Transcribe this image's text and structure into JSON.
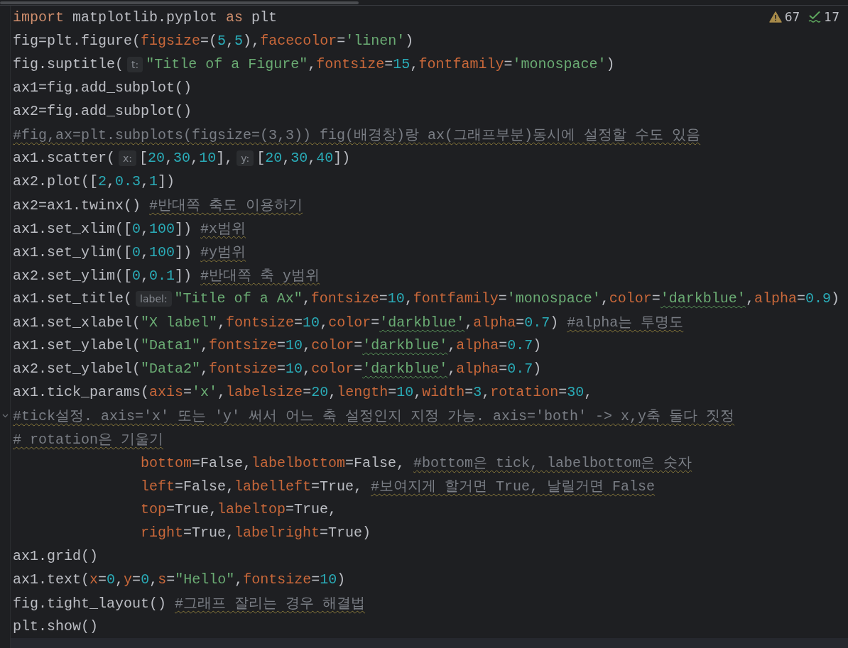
{
  "inspections": {
    "warnings": "67",
    "passed": "17"
  },
  "lines": [
    {
      "tokens": [
        {
          "text": "import",
          "kind": "keyword"
        },
        {
          "text": " matplotlib.pyplot ",
          "kind": "plain"
        },
        {
          "text": "as",
          "kind": "keyword"
        },
        {
          "text": " plt",
          "kind": "plain"
        }
      ]
    },
    {
      "tokens": [
        {
          "text": "fig=plt.figure(",
          "kind": "plain"
        },
        {
          "text": "figsize",
          "kind": "param"
        },
        {
          "text": "=(",
          "kind": "plain"
        },
        {
          "text": "5",
          "kind": "number"
        },
        {
          "text": ",",
          "kind": "plain"
        },
        {
          "text": "5",
          "kind": "number"
        },
        {
          "text": "),",
          "kind": "plain"
        },
        {
          "text": "facecolor",
          "kind": "param"
        },
        {
          "text": "=",
          "kind": "plain"
        },
        {
          "text": "'linen'",
          "kind": "string"
        },
        {
          "text": ")",
          "kind": "plain"
        }
      ]
    },
    {
      "tokens": [
        {
          "text": "fig.suptitle(",
          "kind": "plain"
        },
        {
          "text": "t:",
          "kind": "hint"
        },
        {
          "text": "\"Title of a Figure\"",
          "kind": "string"
        },
        {
          "text": ",",
          "kind": "plain"
        },
        {
          "text": "fontsize",
          "kind": "param"
        },
        {
          "text": "=",
          "kind": "plain"
        },
        {
          "text": "15",
          "kind": "number"
        },
        {
          "text": ",",
          "kind": "plain"
        },
        {
          "text": "fontfamily",
          "kind": "param"
        },
        {
          "text": "=",
          "kind": "plain"
        },
        {
          "text": "'monospace'",
          "kind": "string"
        },
        {
          "text": ")",
          "kind": "plain"
        }
      ]
    },
    {
      "tokens": [
        {
          "text": "ax1=fig.add_subplot()",
          "kind": "plain"
        }
      ]
    },
    {
      "tokens": [
        {
          "text": "ax2=fig.add_subplot()",
          "kind": "plain"
        }
      ]
    },
    {
      "tokens": [
        {
          "text": "#fig,ax=plt.subplots(figsize=(3,3)) fig(배경창)랑 ax(그래프부분)동시에 설정할 수도 있음",
          "kind": "comment",
          "underline": true
        }
      ]
    },
    {
      "tokens": [
        {
          "text": "ax1.scatter(",
          "kind": "plain"
        },
        {
          "text": "x:",
          "kind": "hint"
        },
        {
          "text": "[",
          "kind": "plain"
        },
        {
          "text": "20",
          "kind": "number"
        },
        {
          "text": ",",
          "kind": "plain"
        },
        {
          "text": "30",
          "kind": "number"
        },
        {
          "text": ",",
          "kind": "plain"
        },
        {
          "text": "10",
          "kind": "number"
        },
        {
          "text": "],",
          "kind": "plain"
        },
        {
          "text": "y:",
          "kind": "hint"
        },
        {
          "text": "[",
          "kind": "plain"
        },
        {
          "text": "20",
          "kind": "number"
        },
        {
          "text": ",",
          "kind": "plain"
        },
        {
          "text": "30",
          "kind": "number"
        },
        {
          "text": ",",
          "kind": "plain"
        },
        {
          "text": "40",
          "kind": "number"
        },
        {
          "text": "])",
          "kind": "plain"
        }
      ]
    },
    {
      "tokens": [
        {
          "text": "ax2.plot([",
          "kind": "plain"
        },
        {
          "text": "2",
          "kind": "number"
        },
        {
          "text": ",",
          "kind": "plain"
        },
        {
          "text": "0.3",
          "kind": "number"
        },
        {
          "text": ",",
          "kind": "plain"
        },
        {
          "text": "1",
          "kind": "number"
        },
        {
          "text": "])",
          "kind": "plain"
        }
      ]
    },
    {
      "tokens": [
        {
          "text": "ax2=ax1.twinx() ",
          "kind": "plain"
        },
        {
          "text": "#반대쪽 축도 이용하기",
          "kind": "comment",
          "underline": true
        }
      ]
    },
    {
      "tokens": [
        {
          "text": "ax1.set_xlim([",
          "kind": "plain"
        },
        {
          "text": "0",
          "kind": "number"
        },
        {
          "text": ",",
          "kind": "plain"
        },
        {
          "text": "100",
          "kind": "number"
        },
        {
          "text": "]) ",
          "kind": "plain"
        },
        {
          "text": "#x범위",
          "kind": "comment",
          "underline": true
        }
      ]
    },
    {
      "tokens": [
        {
          "text": "ax1.set_ylim([",
          "kind": "plain"
        },
        {
          "text": "0",
          "kind": "number"
        },
        {
          "text": ",",
          "kind": "plain"
        },
        {
          "text": "100",
          "kind": "number"
        },
        {
          "text": "]) ",
          "kind": "plain"
        },
        {
          "text": "#y범위",
          "kind": "comment",
          "underline": true
        }
      ]
    },
    {
      "tokens": [
        {
          "text": "ax2.set_ylim([",
          "kind": "plain"
        },
        {
          "text": "0",
          "kind": "number"
        },
        {
          "text": ",",
          "kind": "plain"
        },
        {
          "text": "0.1",
          "kind": "number"
        },
        {
          "text": "]) ",
          "kind": "plain"
        },
        {
          "text": "#반대쪽 축 y범위",
          "kind": "comment",
          "underline": true
        }
      ]
    },
    {
      "tokens": [
        {
          "text": "ax1.set_title(",
          "kind": "plain"
        },
        {
          "text": "label:",
          "kind": "hint"
        },
        {
          "text": "\"Title of a Ax\"",
          "kind": "string"
        },
        {
          "text": ",",
          "kind": "plain"
        },
        {
          "text": "fontsize",
          "kind": "param"
        },
        {
          "text": "=",
          "kind": "plain"
        },
        {
          "text": "10",
          "kind": "number"
        },
        {
          "text": ",",
          "kind": "plain"
        },
        {
          "text": "fontfamily",
          "kind": "param"
        },
        {
          "text": "=",
          "kind": "plain"
        },
        {
          "text": "'monospace'",
          "kind": "string"
        },
        {
          "text": ",",
          "kind": "plain"
        },
        {
          "text": "color",
          "kind": "param"
        },
        {
          "text": "=",
          "kind": "plain"
        },
        {
          "text": "'darkblue'",
          "kind": "string",
          "underline": true
        },
        {
          "text": ",",
          "kind": "plain"
        },
        {
          "text": "alpha",
          "kind": "param"
        },
        {
          "text": "=",
          "kind": "plain"
        },
        {
          "text": "0.9",
          "kind": "number"
        },
        {
          "text": ")",
          "kind": "plain"
        }
      ]
    },
    {
      "tokens": [
        {
          "text": "ax1.set_xlabel(",
          "kind": "plain"
        },
        {
          "text": "\"X label\"",
          "kind": "string"
        },
        {
          "text": ",",
          "kind": "plain"
        },
        {
          "text": "fontsize",
          "kind": "param"
        },
        {
          "text": "=",
          "kind": "plain"
        },
        {
          "text": "10",
          "kind": "number"
        },
        {
          "text": ",",
          "kind": "plain"
        },
        {
          "text": "color",
          "kind": "param"
        },
        {
          "text": "=",
          "kind": "plain"
        },
        {
          "text": "'darkblue'",
          "kind": "string",
          "underline": true
        },
        {
          "text": ",",
          "kind": "plain"
        },
        {
          "text": "alpha",
          "kind": "param"
        },
        {
          "text": "=",
          "kind": "plain"
        },
        {
          "text": "0.7",
          "kind": "number"
        },
        {
          "text": ") ",
          "kind": "plain"
        },
        {
          "text": "#alpha는 투명도",
          "kind": "comment",
          "underline": true
        }
      ]
    },
    {
      "tokens": [
        {
          "text": "ax1.set_ylabel(",
          "kind": "plain"
        },
        {
          "text": "\"Data1\"",
          "kind": "string"
        },
        {
          "text": ",",
          "kind": "plain"
        },
        {
          "text": "fontsize",
          "kind": "param"
        },
        {
          "text": "=",
          "kind": "plain"
        },
        {
          "text": "10",
          "kind": "number"
        },
        {
          "text": ",",
          "kind": "plain"
        },
        {
          "text": "color",
          "kind": "param"
        },
        {
          "text": "=",
          "kind": "plain"
        },
        {
          "text": "'darkblue'",
          "kind": "string",
          "underline": true
        },
        {
          "text": ",",
          "kind": "plain"
        },
        {
          "text": "alpha",
          "kind": "param"
        },
        {
          "text": "=",
          "kind": "plain"
        },
        {
          "text": "0.7",
          "kind": "number"
        },
        {
          "text": ")",
          "kind": "plain"
        }
      ]
    },
    {
      "tokens": [
        {
          "text": "ax2.set_ylabel(",
          "kind": "plain"
        },
        {
          "text": "\"Data2\"",
          "kind": "string"
        },
        {
          "text": ",",
          "kind": "plain"
        },
        {
          "text": "fontsize",
          "kind": "param"
        },
        {
          "text": "=",
          "kind": "plain"
        },
        {
          "text": "10",
          "kind": "number"
        },
        {
          "text": ",",
          "kind": "plain"
        },
        {
          "text": "color",
          "kind": "param"
        },
        {
          "text": "=",
          "kind": "plain"
        },
        {
          "text": "'darkblue'",
          "kind": "string",
          "underline": true
        },
        {
          "text": ",",
          "kind": "plain"
        },
        {
          "text": "alpha",
          "kind": "param"
        },
        {
          "text": "=",
          "kind": "plain"
        },
        {
          "text": "0.7",
          "kind": "number"
        },
        {
          "text": ")",
          "kind": "plain"
        }
      ]
    },
    {
      "tokens": [
        {
          "text": "ax1.tick_params(",
          "kind": "plain"
        },
        {
          "text": "axis",
          "kind": "param"
        },
        {
          "text": "=",
          "kind": "plain"
        },
        {
          "text": "'x'",
          "kind": "string"
        },
        {
          "text": ",",
          "kind": "plain"
        },
        {
          "text": "labelsize",
          "kind": "param"
        },
        {
          "text": "=",
          "kind": "plain"
        },
        {
          "text": "20",
          "kind": "number"
        },
        {
          "text": ",",
          "kind": "plain"
        },
        {
          "text": "length",
          "kind": "param"
        },
        {
          "text": "=",
          "kind": "plain"
        },
        {
          "text": "10",
          "kind": "number"
        },
        {
          "text": ",",
          "kind": "plain"
        },
        {
          "text": "width",
          "kind": "param"
        },
        {
          "text": "=",
          "kind": "plain"
        },
        {
          "text": "3",
          "kind": "number"
        },
        {
          "text": ",",
          "kind": "plain"
        },
        {
          "text": "rotation",
          "kind": "param"
        },
        {
          "text": "=",
          "kind": "plain"
        },
        {
          "text": "30",
          "kind": "number"
        },
        {
          "text": ",",
          "kind": "plain"
        }
      ]
    },
    {
      "fold_marker": true,
      "tokens": [
        {
          "text": "#tick설정. axis='x' 또는 'y' 써서 어느 축 설정인지 지정 가능. axis='both' -> x,y축 둘다 짓정",
          "kind": "comment",
          "underline": true
        }
      ]
    },
    {
      "tokens": [
        {
          "text": "# rotation은 기울기",
          "kind": "comment",
          "underline": true
        }
      ]
    },
    {
      "indented": true,
      "tokens": [
        {
          "text": "bottom",
          "kind": "param"
        },
        {
          "text": "=False,",
          "kind": "plain"
        },
        {
          "text": "labelbottom",
          "kind": "param"
        },
        {
          "text": "=False, ",
          "kind": "plain"
        },
        {
          "text": "#bottom은 tick, labelbottom은 숫자",
          "kind": "comment",
          "underline": true
        }
      ]
    },
    {
      "indented": true,
      "tokens": [
        {
          "text": "left",
          "kind": "param"
        },
        {
          "text": "=False,",
          "kind": "plain"
        },
        {
          "text": "labelleft",
          "kind": "param"
        },
        {
          "text": "=True, ",
          "kind": "plain"
        },
        {
          "text": "#보여지게 할거면 True, 날릴거면 False",
          "kind": "comment",
          "underline": true
        }
      ]
    },
    {
      "indented": true,
      "tokens": [
        {
          "text": "top",
          "kind": "param"
        },
        {
          "text": "=True,",
          "kind": "plain"
        },
        {
          "text": "labeltop",
          "kind": "param"
        },
        {
          "text": "=True,",
          "kind": "plain"
        }
      ]
    },
    {
      "indented": true,
      "tokens": [
        {
          "text": "right",
          "kind": "param"
        },
        {
          "text": "=True,",
          "kind": "plain"
        },
        {
          "text": "labelright",
          "kind": "param"
        },
        {
          "text": "=True)",
          "kind": "plain"
        }
      ]
    },
    {
      "tokens": [
        {
          "text": "ax1.grid()",
          "kind": "plain"
        }
      ]
    },
    {
      "tokens": [
        {
          "text": "ax1.text(",
          "kind": "plain"
        },
        {
          "text": "x",
          "kind": "param"
        },
        {
          "text": "=",
          "kind": "plain"
        },
        {
          "text": "0",
          "kind": "number"
        },
        {
          "text": ",",
          "kind": "plain"
        },
        {
          "text": "y",
          "kind": "param"
        },
        {
          "text": "=",
          "kind": "plain"
        },
        {
          "text": "0",
          "kind": "number"
        },
        {
          "text": ",",
          "kind": "plain"
        },
        {
          "text": "s",
          "kind": "param"
        },
        {
          "text": "=",
          "kind": "plain"
        },
        {
          "text": "\"Hello\"",
          "kind": "string"
        },
        {
          "text": ",",
          "kind": "plain"
        },
        {
          "text": "fontsize",
          "kind": "param"
        },
        {
          "text": "=",
          "kind": "plain"
        },
        {
          "text": "10",
          "kind": "number"
        },
        {
          "text": ")",
          "kind": "plain"
        }
      ]
    },
    {
      "tokens": [
        {
          "text": "fig.tight_layout() ",
          "kind": "plain"
        },
        {
          "text": "#그래프 잘리는 경우 해결법",
          "kind": "comment",
          "underline": true
        }
      ]
    },
    {
      "tokens": [
        {
          "text": "plt.show()",
          "kind": "plain"
        }
      ]
    },
    {
      "current": true
    }
  ]
}
